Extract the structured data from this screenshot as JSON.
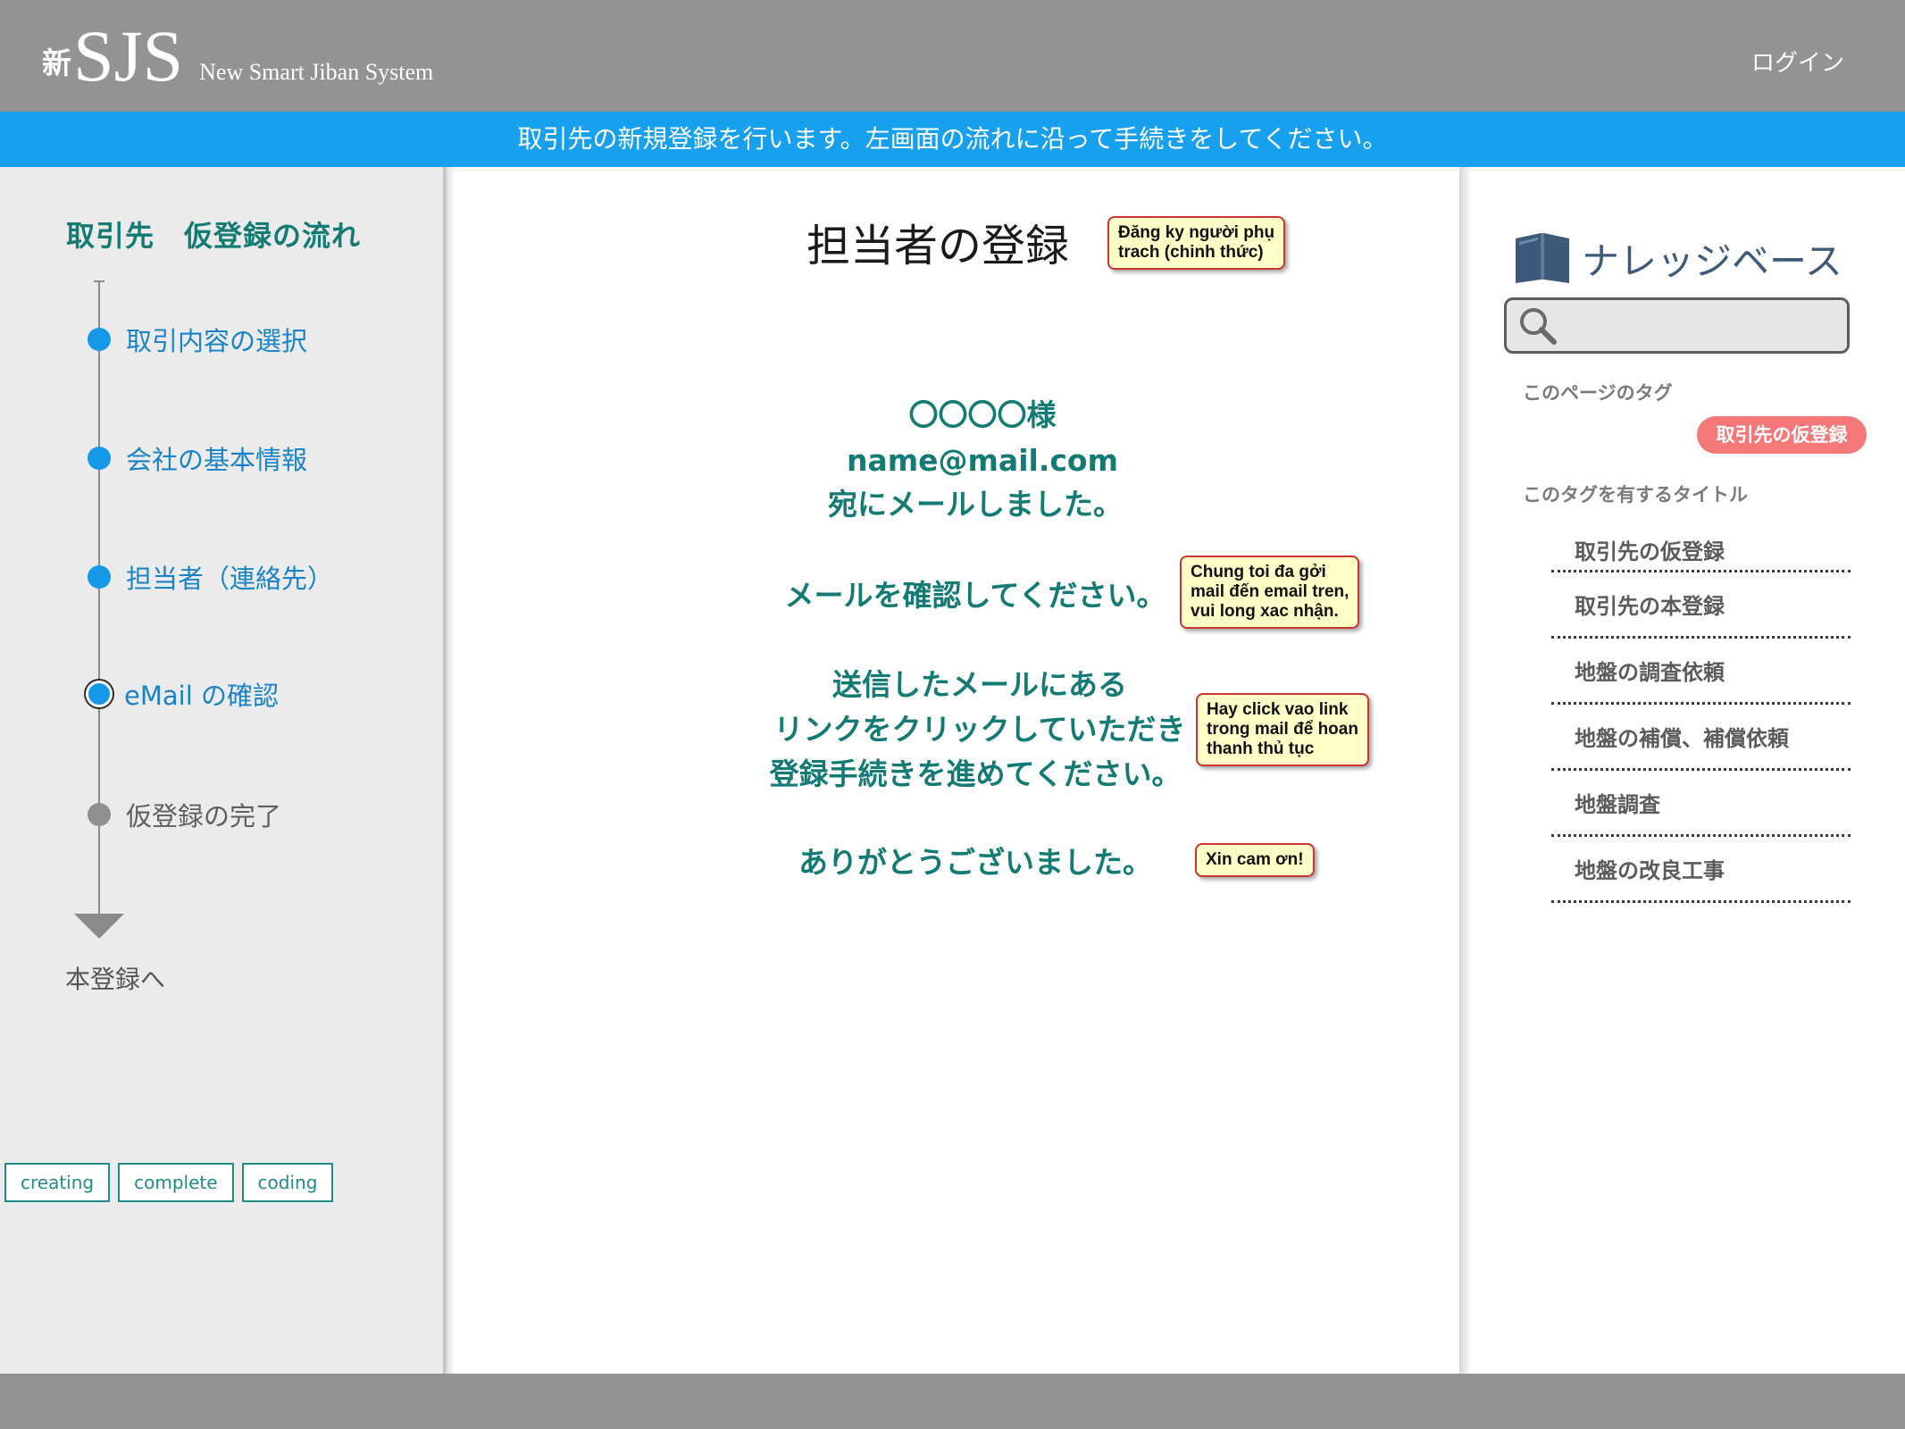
{
  "header": {
    "logo_kanji": "新",
    "logo_main": "SJS",
    "logo_sub": "New Smart Jiban System",
    "login_label": "ログイン"
  },
  "infobar": {
    "text": "取引先の新規登録を行います。左画面の流れに沿って手続きをしてください。"
  },
  "sidebar": {
    "title": "取引先　仮登録の流れ",
    "steps": [
      {
        "label": "取引内容の選択",
        "state": "done"
      },
      {
        "label": "会社の基本情報",
        "state": "done"
      },
      {
        "label": "担当者（連絡先）",
        "state": "done"
      },
      {
        "label": "eMail の確認",
        "state": "current"
      },
      {
        "label": "仮登録の完了",
        "state": "pending"
      }
    ],
    "next_label": "本登録へ",
    "status_tags": [
      "creating",
      "complete",
      "coding"
    ]
  },
  "main": {
    "page_title": "担当者の登録",
    "recipient_name": "〇〇〇〇様",
    "recipient_email": "name@mail.com",
    "sent_line": "宛にメールしました。",
    "confirm_line": "メールを確認してください。",
    "link_lines": [
      "送信したメールにある",
      "リンクをクリックしていただき",
      "登録手続きを進めてください。"
    ],
    "thanks_line": "ありがとうございました。",
    "notes": {
      "title_note": "Đăng ky người phụ\ntrach (chinh thức)",
      "confirm_note": "Chung toi đa gởi\nmail đến email tren,\nvui long xac nhận.",
      "link_note": "Hay click vao link\ntrong mail để hoan\nthanh thủ tục",
      "thanks_note": "Xin cam ơn!"
    }
  },
  "knowledge": {
    "title": "ナレッジベース",
    "search_placeholder": "",
    "page_tags_label": "このページのタグ",
    "tag": "取引先の仮登録",
    "titles_label": "このタグを有するタイトル",
    "titles": [
      "取引先の仮登録",
      "取引先の本登録",
      "地盤の調査依頼",
      "地盤の補償、補償依頼",
      "地盤調査",
      "地盤の改良工事"
    ]
  },
  "colors": {
    "header_gray": "#939393",
    "info_blue": "#16a0ee",
    "teal": "#137a74",
    "step_blue": "#1698e8",
    "tag_red": "#f47878",
    "note_yellow": "#ffffc8",
    "note_border": "#cc3333"
  },
  "icons": [
    "book-icon",
    "search-icon"
  ]
}
